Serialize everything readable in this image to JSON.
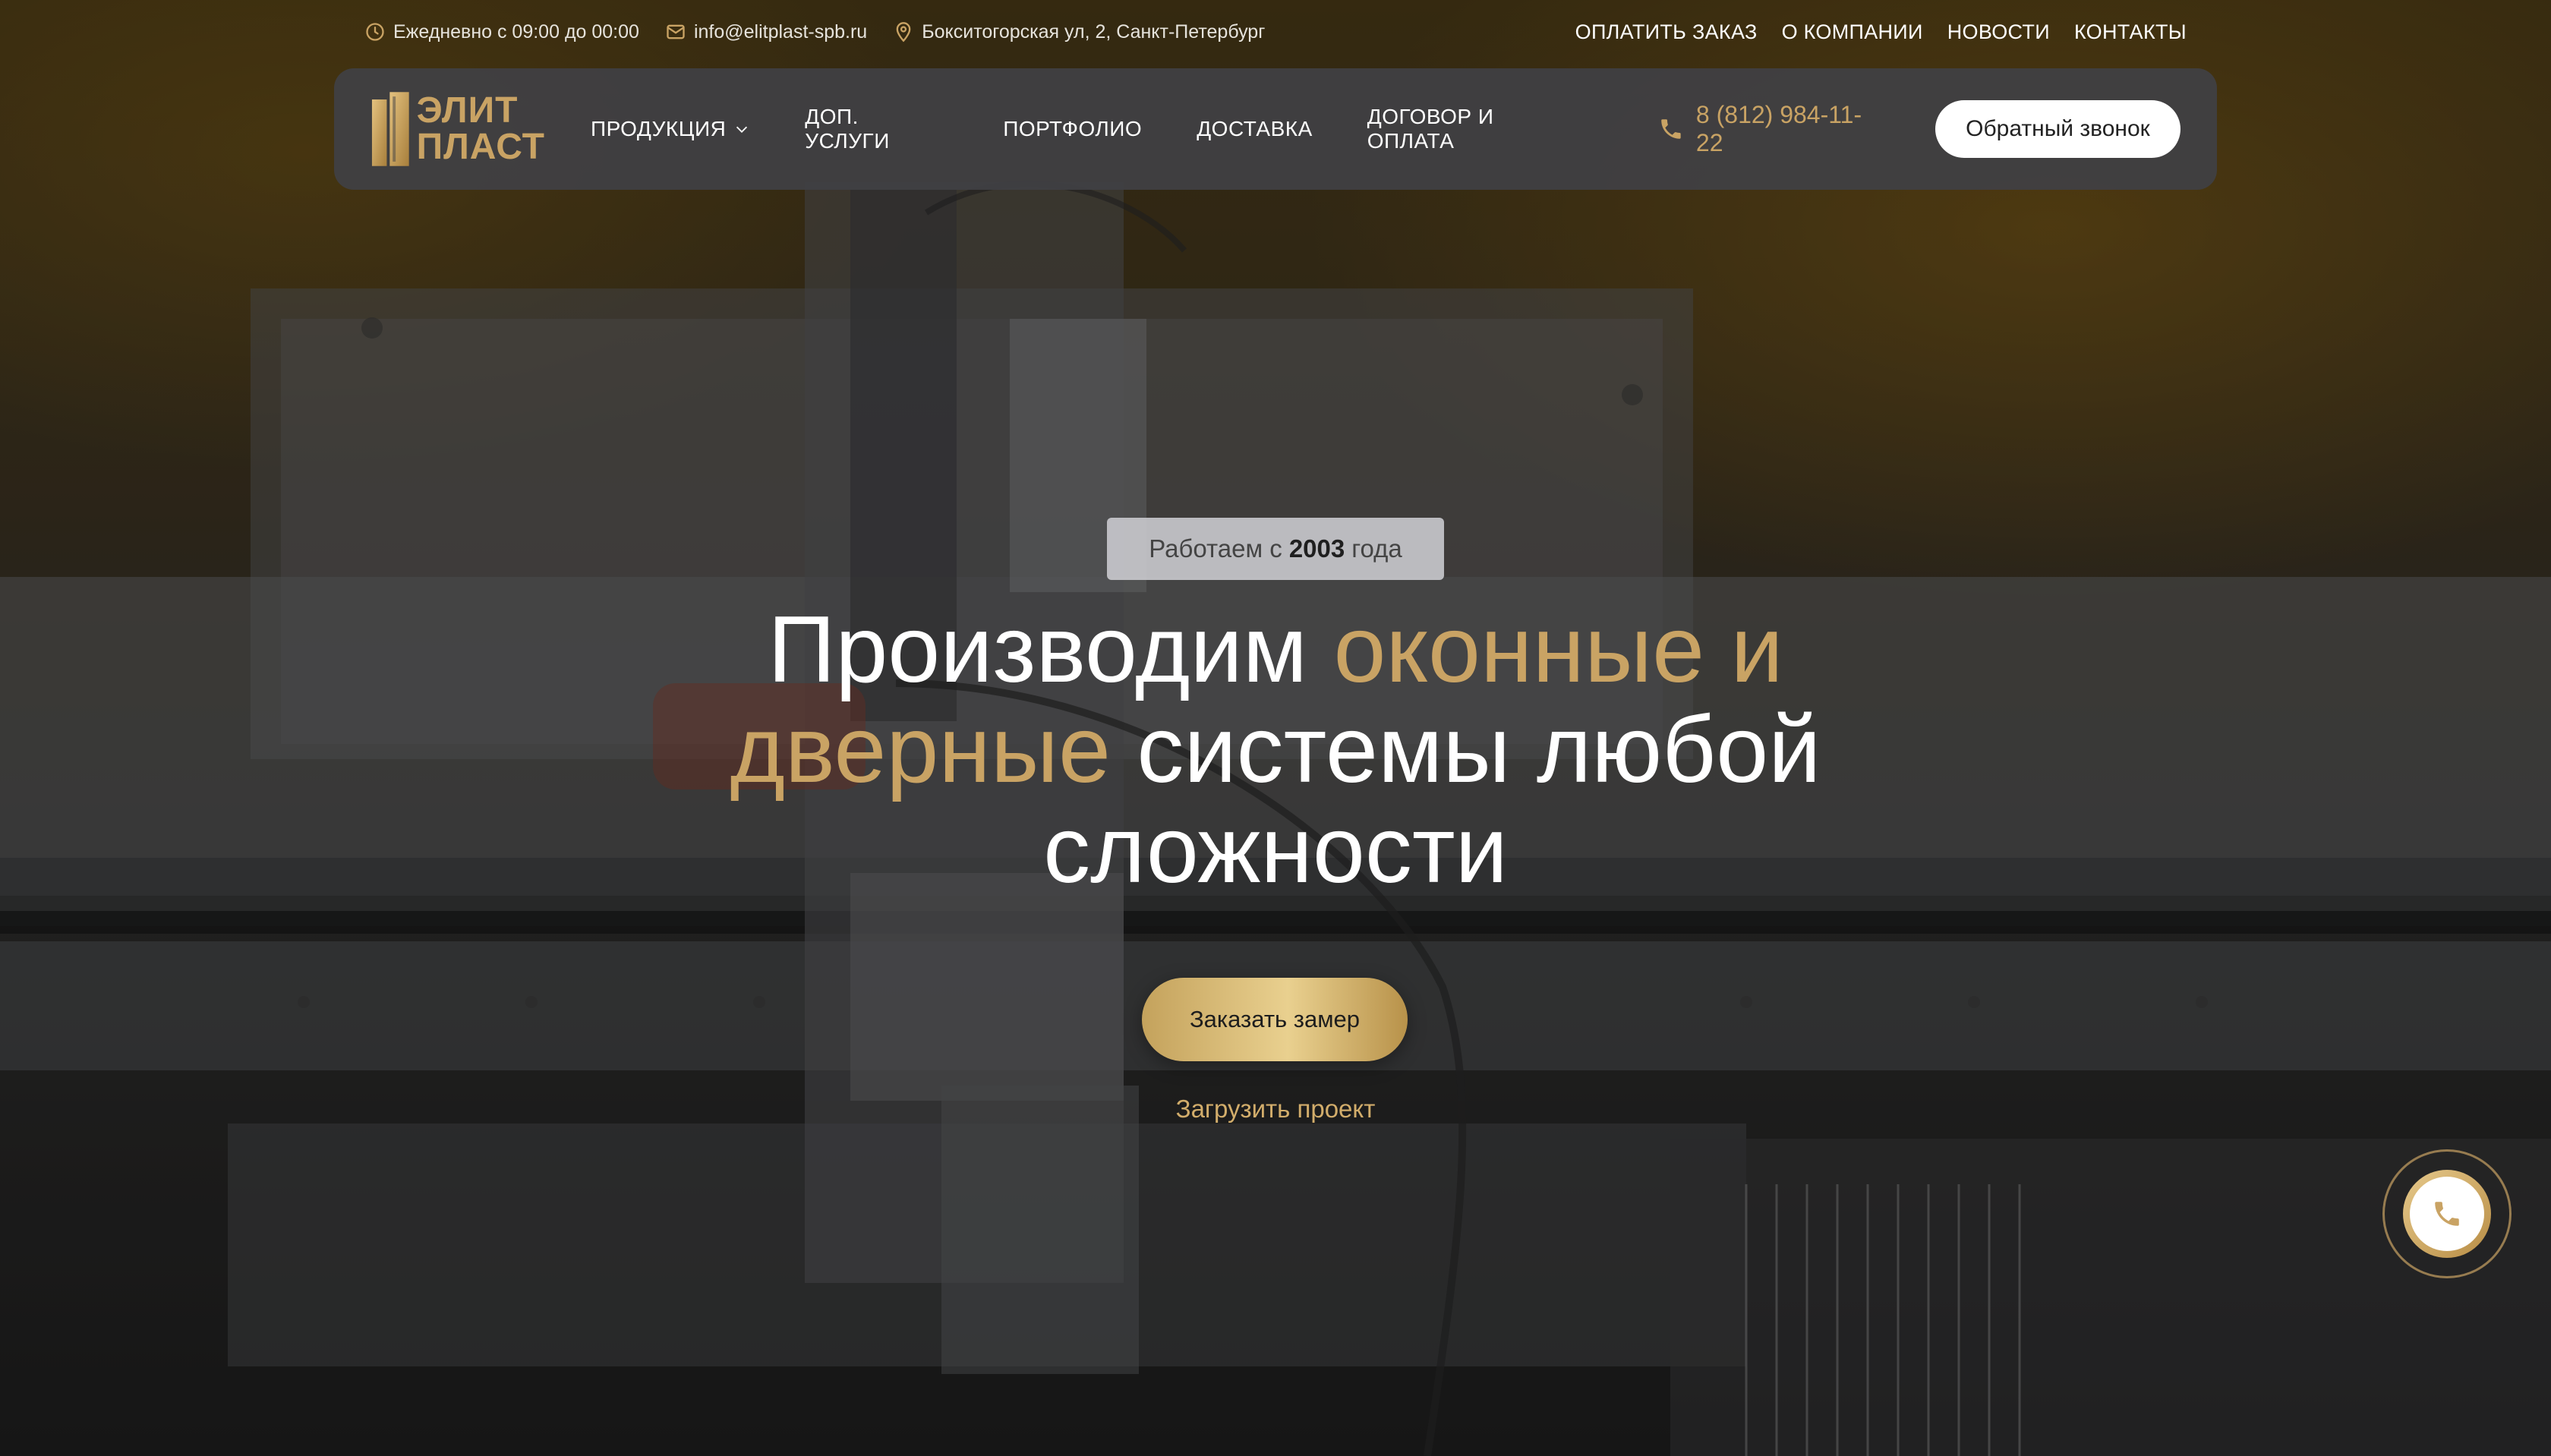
{
  "topbar": {
    "hours": "Ежедневно с 09:00 до 00:00",
    "email": "info@elitplast-spb.ru",
    "address": "Бокситогорская ул, 2, Санкт-Петербург",
    "links": [
      "ОПЛАТИТЬ ЗАКАЗ",
      "О КОМПАНИИ",
      "НОВОСТИ",
      "КОНТАКТЫ"
    ]
  },
  "header": {
    "logo_line1": "ЭЛИТ",
    "logo_line2": "ПЛАСТ",
    "nav": [
      "ПРОДУКЦИЯ",
      "ДОП. УСЛУГИ",
      "ПОРТФОЛИО",
      "ДОСТАВКА",
      "ДОГОВОР И ОПЛАТА"
    ],
    "phone": "8 (812) 984-11-22",
    "callback_label": "Обратный звонок"
  },
  "hero": {
    "badge_prefix": "Работаем с",
    "badge_year": "2003",
    "badge_suffix": "года",
    "headline_part1": "Производим",
    "headline_accent1": "оконные и дверные",
    "headline_part2": "системы любой сложности",
    "cta_label": "Заказать замер",
    "upload_label": "Загрузить проект"
  },
  "icons": {
    "hours": "clock-icon",
    "email": "mail-icon",
    "address": "location-pin-icon",
    "dropdown": "chevron-down-icon",
    "phone": "phone-icon",
    "float_call": "phone-icon"
  },
  "colors": {
    "accent_gold": "#c9a364",
    "header_bg": "#404044",
    "callback_bg": "#ffffff",
    "badge_bg": "#cdcdd2"
  }
}
